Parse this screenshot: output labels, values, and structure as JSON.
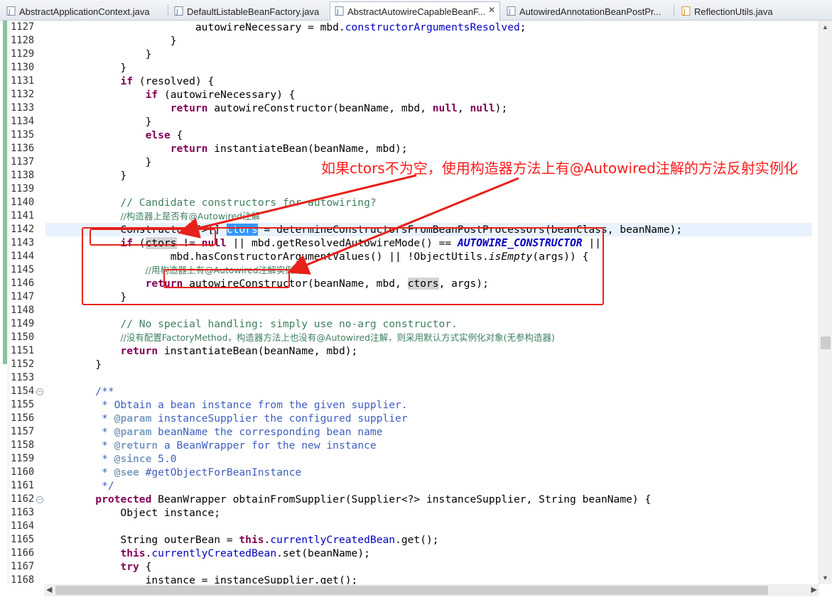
{
  "tabs": [
    {
      "label": "AbstractApplicationContext.java",
      "active": false
    },
    {
      "label": "DefaultListableBeanFactory.java",
      "active": false
    },
    {
      "label": "AbstractAutowireCapableBeanF...",
      "active": true
    },
    {
      "label": "AutowiredAnnotationBeanPostPr...",
      "active": false
    },
    {
      "label": "ReflectionUtils.java",
      "active": false
    }
  ],
  "tab_close_glyph": "✕",
  "line_numbers": [
    "1127",
    "1128",
    "1129",
    "1130",
    "1131",
    "1132",
    "1133",
    "1134",
    "1135",
    "1136",
    "1137",
    "1138",
    "1139",
    "1140",
    "1141",
    "1142",
    "1143",
    "1144",
    "1145",
    "1146",
    "1147",
    "1148",
    "1149",
    "1150",
    "1151",
    "1152",
    "1153",
    "1154",
    "1155",
    "1156",
    "1157",
    "1158",
    "1159",
    "1160",
    "1161",
    "1162",
    "1163",
    "1164",
    "1165",
    "1166",
    "1167",
    "1168"
  ],
  "folded_lines": [
    "1154",
    "1162"
  ],
  "fold_glyph": "−",
  "code_lines": [
    [
      {
        "t": "                        autowireNecessary = mbd."
      },
      {
        "t": "constructorArgumentsResolved",
        "c": "fd"
      },
      {
        "t": ";"
      }
    ],
    [
      {
        "t": "                    }"
      }
    ],
    [
      {
        "t": "                }"
      }
    ],
    [
      {
        "t": "            }"
      }
    ],
    [
      {
        "t": "            "
      },
      {
        "t": "if",
        "c": "kw"
      },
      {
        "t": " (resolved) {"
      }
    ],
    [
      {
        "t": "                "
      },
      {
        "t": "if",
        "c": "kw"
      },
      {
        "t": " (autowireNecessary) {"
      }
    ],
    [
      {
        "t": "                    "
      },
      {
        "t": "return",
        "c": "kw"
      },
      {
        "t": " autowireConstructor(beanName, mbd, "
      },
      {
        "t": "null",
        "c": "kw"
      },
      {
        "t": ", "
      },
      {
        "t": "null",
        "c": "kw"
      },
      {
        "t": ");"
      }
    ],
    [
      {
        "t": "                }"
      }
    ],
    [
      {
        "t": "                "
      },
      {
        "t": "else",
        "c": "kw"
      },
      {
        "t": " {"
      }
    ],
    [
      {
        "t": "                    "
      },
      {
        "t": "return",
        "c": "kw"
      },
      {
        "t": " instantiateBean(beanName, mbd);"
      }
    ],
    [
      {
        "t": "                }"
      }
    ],
    [
      {
        "t": "            }"
      }
    ],
    [
      {
        "t": ""
      }
    ],
    [
      {
        "t": "            "
      },
      {
        "t": "// Candidate constructors for autowiring?",
        "c": "cm"
      }
    ],
    [
      {
        "t": "            "
      },
      {
        "t": "//构造器上是否有@Autowired注解",
        "c": "cm cmt-cn"
      }
    ],
    [
      {
        "t": "            Constructor<?>[] "
      },
      {
        "t": "ctors",
        "c": "sel"
      },
      {
        "t": " = determineConstructorsFromBeanPostProcessors(beanClass, beanName);"
      }
    ],
    [
      {
        "t": "            "
      },
      {
        "t": "if",
        "c": "kw"
      },
      {
        "t": " ("
      },
      {
        "t": "ctors",
        "c": "hl"
      },
      {
        "t": " != "
      },
      {
        "t": "null",
        "c": "kw"
      },
      {
        "t": " || mbd.getResolvedAutowireMode() == "
      },
      {
        "t": "AUTOWIRE_CONSTRUCTOR",
        "c": "cs"
      },
      {
        "t": " ||"
      }
    ],
    [
      {
        "t": "                    mbd.hasConstructorArgumentValues() || !ObjectUtils."
      },
      {
        "t": "isEmpty",
        "c": "it"
      },
      {
        "t": "(args)) {"
      }
    ],
    [
      {
        "t": "                "
      },
      {
        "t": "//用构造器上有@Autowired注解实例化",
        "c": "cm cmt-cn"
      }
    ],
    [
      {
        "t": "                "
      },
      {
        "t": "return",
        "c": "kw"
      },
      {
        "t": " autowireConstructor(beanName, mbd, "
      },
      {
        "t": "ctors",
        "c": "hl"
      },
      {
        "t": ", args);"
      }
    ],
    [
      {
        "t": "            }"
      }
    ],
    [
      {
        "t": ""
      }
    ],
    [
      {
        "t": "            "
      },
      {
        "t": "// No special handling: simply use no-arg constructor.",
        "c": "cm"
      }
    ],
    [
      {
        "t": "            "
      },
      {
        "t": "//没有配置FactoryMethod，构造器方法上也没有@Autowired注解，则采用默认方式实例化对象(无参构造器)",
        "c": "cm cmt-cn"
      }
    ],
    [
      {
        "t": "            "
      },
      {
        "t": "return",
        "c": "kw"
      },
      {
        "t": " instantiateBean(beanName, mbd);"
      }
    ],
    [
      {
        "t": "        }"
      }
    ],
    [
      {
        "t": ""
      }
    ],
    [
      {
        "t": "        "
      },
      {
        "t": "/**",
        "c": "jd"
      }
    ],
    [
      {
        "t": "         * Obtain a bean instance from the given supplier.",
        "c": "jd"
      }
    ],
    [
      {
        "t": "         * ",
        "c": "jd"
      },
      {
        "t": "@param",
        "c": "jt"
      },
      {
        "t": " instanceSupplier the configured supplier",
        "c": "jd"
      }
    ],
    [
      {
        "t": "         * ",
        "c": "jd"
      },
      {
        "t": "@param",
        "c": "jt"
      },
      {
        "t": " beanName the corresponding bean name",
        "c": "jd"
      }
    ],
    [
      {
        "t": "         * ",
        "c": "jd"
      },
      {
        "t": "@return",
        "c": "jt"
      },
      {
        "t": " a BeanWrapper for the new instance",
        "c": "jd"
      }
    ],
    [
      {
        "t": "         * ",
        "c": "jd"
      },
      {
        "t": "@since",
        "c": "jt"
      },
      {
        "t": " 5.0",
        "c": "jd"
      }
    ],
    [
      {
        "t": "         * ",
        "c": "jd"
      },
      {
        "t": "@see",
        "c": "jt"
      },
      {
        "t": " #getObjectForBeanInstance",
        "c": "jd"
      }
    ],
    [
      {
        "t": "         */",
        "c": "jd"
      }
    ],
    [
      {
        "t": "        "
      },
      {
        "t": "protected",
        "c": "kw"
      },
      {
        "t": " BeanWrapper obtainFromSupplier(Supplier<?> instanceSupplier, String beanName) {"
      }
    ],
    [
      {
        "t": "            Object instance;"
      }
    ],
    [
      {
        "t": ""
      }
    ],
    [
      {
        "t": "            String outerBean = "
      },
      {
        "t": "this",
        "c": "kw"
      },
      {
        "t": "."
      },
      {
        "t": "currentlyCreatedBean",
        "c": "fd"
      },
      {
        "t": ".get();"
      }
    ],
    [
      {
        "t": "            "
      },
      {
        "t": "this",
        "c": "kw"
      },
      {
        "t": "."
      },
      {
        "t": "currentlyCreatedBean",
        "c": "fd"
      },
      {
        "t": ".set(beanName);"
      }
    ],
    [
      {
        "t": "            "
      },
      {
        "t": "try",
        "c": "kw"
      },
      {
        "t": " {"
      }
    ],
    [
      {
        "t": "                instance = instanceSupplier.get();"
      }
    ]
  ],
  "current_line": "1142",
  "annotation": {
    "text": "如果ctors不为空，使用构造器方法上有@Autowired注解的方法反射实例化",
    "color": "#ff1a1a"
  },
  "scrollbar": {
    "up_glyph": "▲",
    "down_glyph": "▼",
    "left_glyph": "◀",
    "right_glyph": "▶"
  }
}
